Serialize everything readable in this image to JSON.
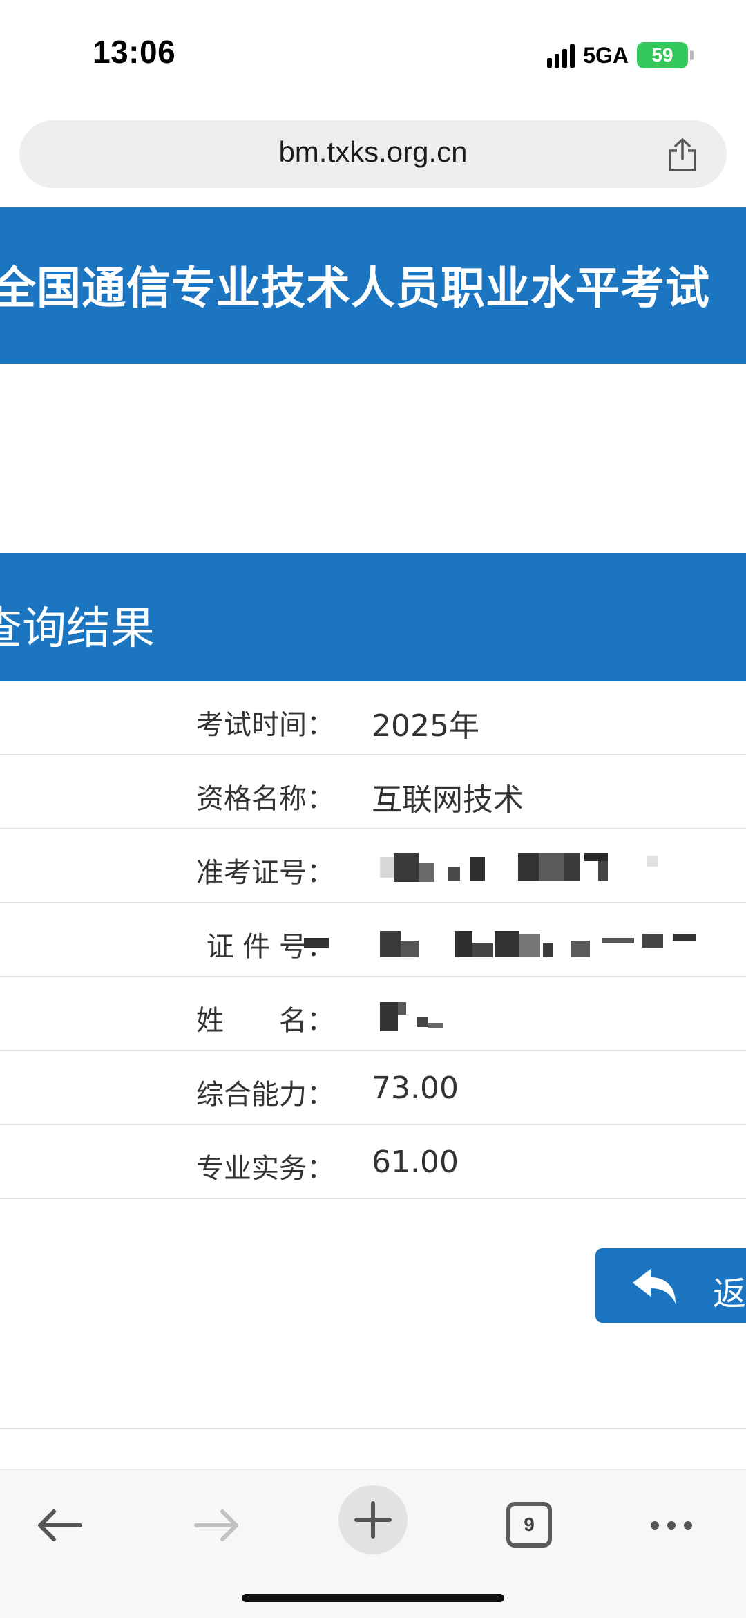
{
  "status_bar": {
    "time": "13:06",
    "network": "5GA",
    "battery": "59"
  },
  "browser": {
    "url": "bm.txks.org.cn",
    "tab_count": "9"
  },
  "banner": {
    "title": "全国通信专业技术人员职业水平考试"
  },
  "result": {
    "title": "查询结果",
    "rows": [
      {
        "label": "考试时间：",
        "value": "2025年"
      },
      {
        "label": "资格名称：",
        "value": "互联网技术"
      },
      {
        "label": "准考证号：",
        "value": ""
      },
      {
        "label": "证 件 号：",
        "value": ""
      },
      {
        "label": "姓　　名：",
        "value": ""
      },
      {
        "label": "综合能力：",
        "value": "73.00"
      },
      {
        "label": "专业实务：",
        "value": "61.00"
      }
    ]
  },
  "back_button": {
    "label": "返回"
  },
  "colors": {
    "primary": "#1c75c1",
    "battery": "#34c759"
  },
  "icons": {
    "share": "share-icon",
    "back": "undo-arrow-icon",
    "nav_back": "arrow-left-icon",
    "nav_forward": "arrow-right-icon",
    "new_tab": "plus-icon",
    "more": "ellipsis-icon"
  }
}
